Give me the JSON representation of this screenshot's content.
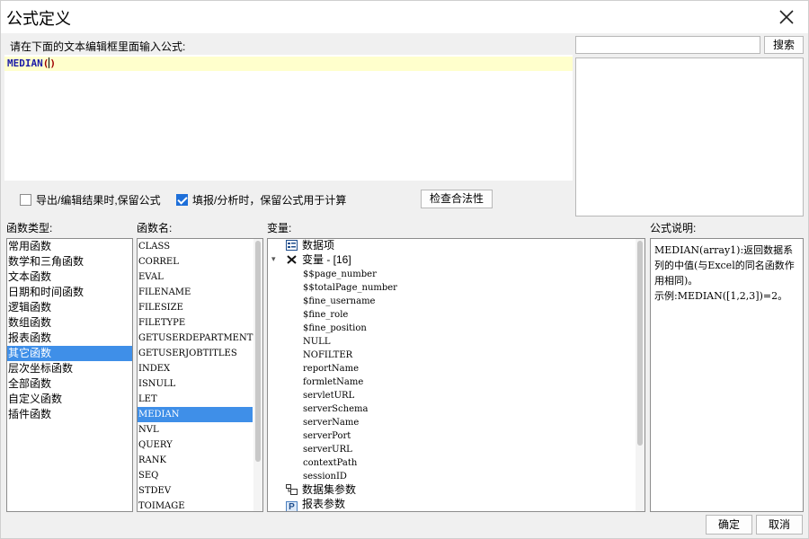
{
  "window": {
    "title": "公式定义"
  },
  "editor": {
    "prompt": "请在下面的文本编辑框里面输入公式:",
    "func_name": "MEDIAN",
    "open_paren": "(",
    "close_paren": ")"
  },
  "search": {
    "value": "",
    "button": "搜索"
  },
  "options": {
    "keep_formula_export": {
      "label": "导出/编辑结果时,保留公式",
      "checked": false
    },
    "keep_formula_fill": {
      "label": "填报/分析时，保留公式用于计算",
      "checked": true
    },
    "check_button": "检查合法性"
  },
  "labels": {
    "categories": "函数类型:",
    "functions": "函数名:",
    "variables": "变量:",
    "description": "公式说明:"
  },
  "categories": [
    "常用函数",
    "数学和三角函数",
    "文本函数",
    "日期和时间函数",
    "逻辑函数",
    "数组函数",
    "报表函数",
    "其它函数",
    "层次坐标函数",
    "全部函数",
    "自定义函数",
    "插件函数"
  ],
  "selected_category": "其它函数",
  "functions": [
    "CLASS",
    "CORREL",
    "EVAL",
    "FILENAME",
    "FILESIZE",
    "FILETYPE",
    "GETUSERDEPARTMENTS",
    "GETUSERJOBTITLES",
    "INDEX",
    "ISNULL",
    "LET",
    "MEDIAN",
    "NVL",
    "QUERY",
    "RANK",
    "SEQ",
    "STDEV",
    "TOIMAGE"
  ],
  "selected_function": "MEDIAN",
  "variables": {
    "data_item": "数据项",
    "var_group": "变量 - [16]",
    "vars": [
      "$$page_number",
      "$$totalPage_number",
      "$fine_username",
      "$fine_role",
      "$fine_position",
      "NULL",
      "NOFILTER",
      "reportName",
      "formletName",
      "servletURL",
      "serverSchema",
      "serverName",
      "serverPort",
      "serverURL",
      "contextPath",
      "sessionID"
    ],
    "dataset_params": "数据集参数",
    "report_params": "报表参数"
  },
  "description": {
    "line1": "MEDIAN(array1):返回数据系列的中值(与Excel的同名函数作用相同)。",
    "line2": "示例:MEDIAN([1,2,3])=2。"
  },
  "footer": {
    "ok": "确定",
    "cancel": "取消"
  },
  "colors": {
    "selection": "#3f8fe8",
    "editor_line": "#ffffcc",
    "check_blue": "#1e6fd9"
  }
}
